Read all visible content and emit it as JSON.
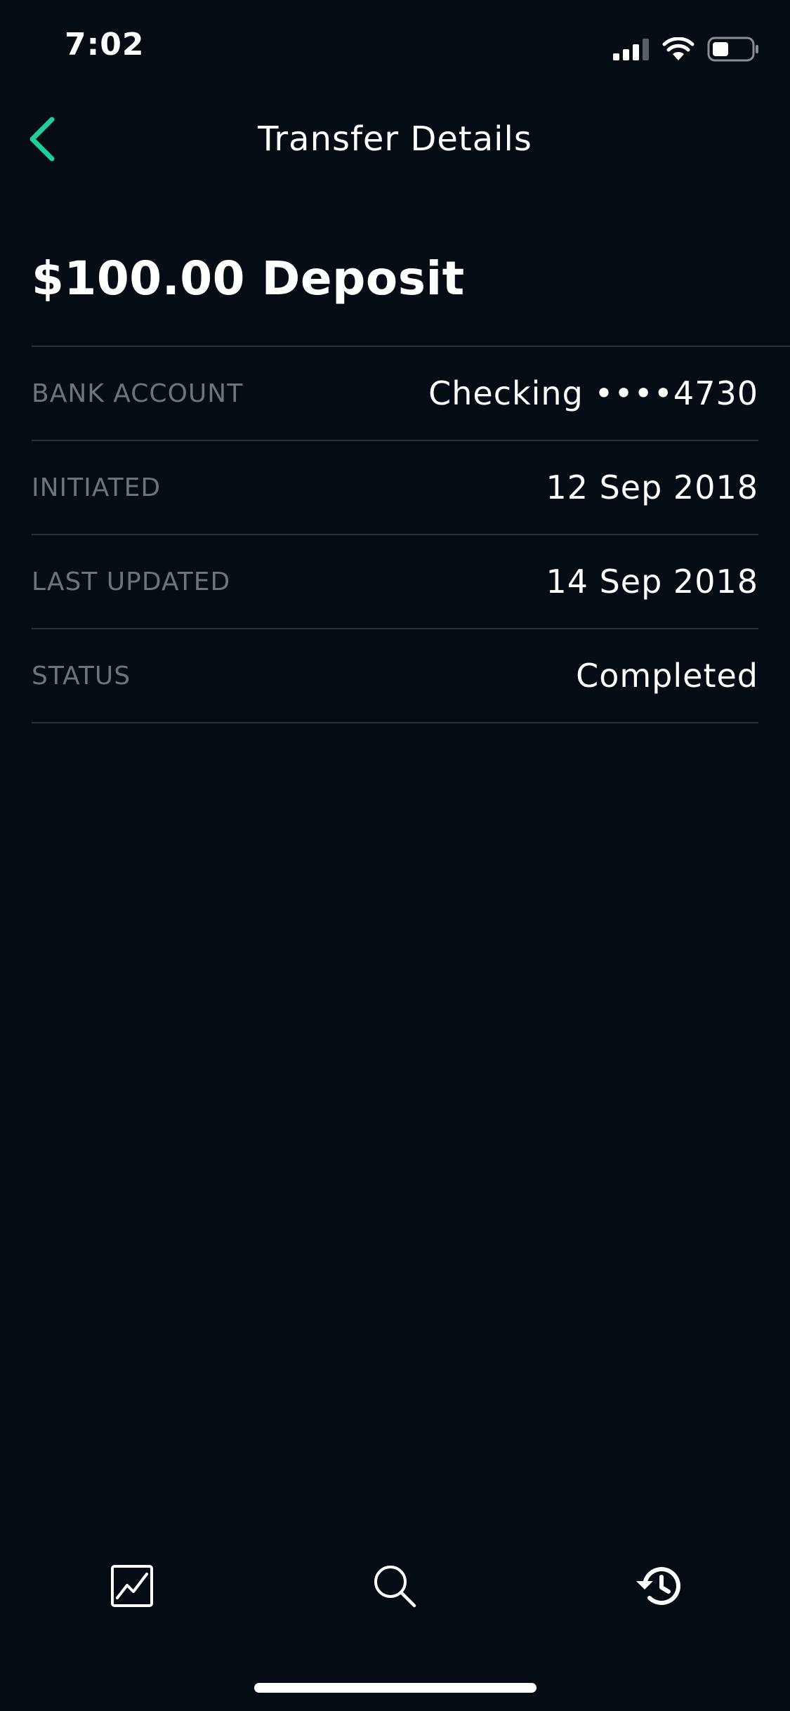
{
  "status_bar": {
    "time": "7:02"
  },
  "nav": {
    "title": "Transfer Details",
    "back_icon": "chevron-left-icon",
    "accent_color": "#21ce99"
  },
  "transfer": {
    "heading": "$100.00 Deposit",
    "rows": [
      {
        "label": "BANK ACCOUNT",
        "value": "Checking ••••4730"
      },
      {
        "label": "INITIATED",
        "value": "12 Sep 2018"
      },
      {
        "label": "LAST UPDATED",
        "value": "14 Sep 2018"
      },
      {
        "label": "STATUS",
        "value": "Completed"
      }
    ]
  },
  "tab_bar": {
    "tabs": [
      {
        "icon": "chart-icon"
      },
      {
        "icon": "search-icon"
      },
      {
        "icon": "history-icon"
      }
    ]
  },
  "colors": {
    "background": "#050c13",
    "divider": "#2a3238",
    "label": "#6c757b",
    "text": "#ffffff"
  }
}
